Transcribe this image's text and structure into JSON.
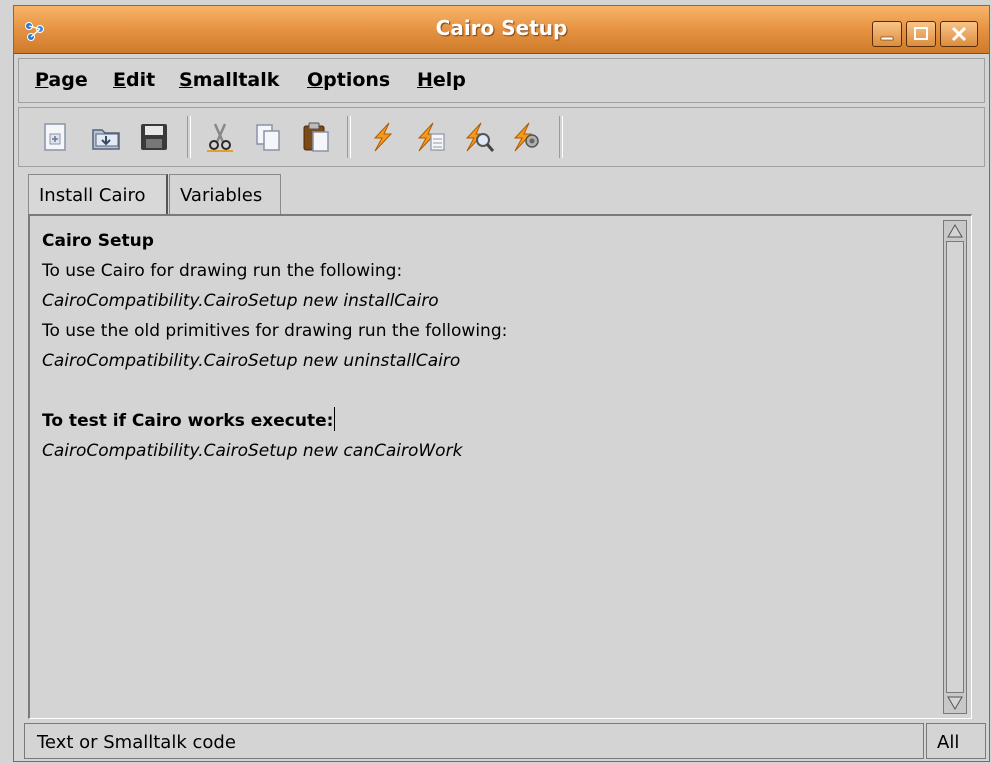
{
  "window": {
    "title": "Cairo Setup",
    "title_bar_color": "#e89645",
    "controls": {
      "minimize_icon": "minimize-icon",
      "maximize_icon": "maximize-icon",
      "close_icon": "close-icon"
    }
  },
  "menubar": {
    "items": [
      {
        "label_ul": "P",
        "label_rest": "age"
      },
      {
        "label_ul": "E",
        "label_rest": "dit"
      },
      {
        "label_ul": "S",
        "label_rest": "malltalk"
      },
      {
        "label_ul": "O",
        "label_rest": "ptions"
      },
      {
        "label_ul": "H",
        "label_rest": "elp"
      }
    ]
  },
  "toolbar": {
    "icons": [
      "new-page-icon",
      "open-file-icon",
      "save-icon",
      "cut-icon",
      "copy-icon",
      "paste-icon",
      "do-it-icon",
      "print-it-icon",
      "inspect-it-icon",
      "debug-it-icon"
    ]
  },
  "tabs": [
    {
      "label": "Install Cairo"
    },
    {
      "label": "Variables"
    }
  ],
  "editor": {
    "lines": [
      {
        "text": "Cairo Setup",
        "style": "bold"
      },
      {
        "text": "To use Cairo for drawing run the following:",
        "style": "normal"
      },
      {
        "text": "CairoCompatibility.CairoSetup new installCairo",
        "style": "italic"
      },
      {
        "text": "To use the old primitives for drawing run the following:",
        "style": "normal"
      },
      {
        "text": "CairoCompatibility.CairoSetup new uninstallCairo",
        "style": "italic"
      },
      {
        "text": "",
        "style": "normal"
      },
      {
        "text": "To test if Cairo works execute:",
        "style": "bold"
      },
      {
        "text": "CairoCompatibility.CairoSetup new canCairoWork",
        "style": "italic"
      }
    ]
  },
  "statusbar": {
    "left": "Text or Smalltalk code",
    "right": "All"
  }
}
